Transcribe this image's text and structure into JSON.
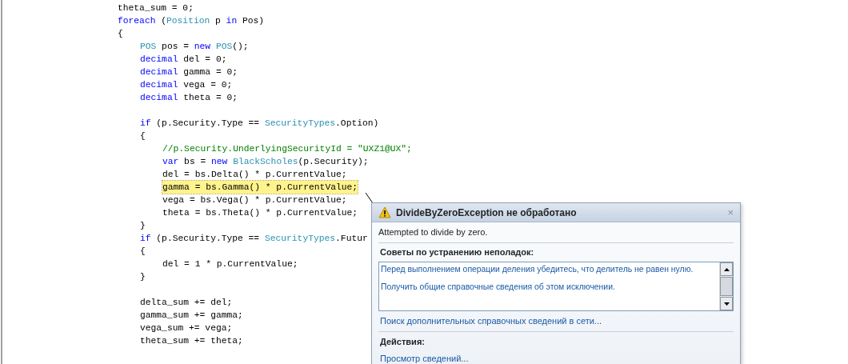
{
  "code_lines": [
    {
      "highlighted": false,
      "tokens": [
        {
          "kind": "plain",
          "text": "theta_sum = 0;"
        }
      ]
    },
    {
      "highlighted": false,
      "tokens": [
        {
          "kind": "keyword",
          "text": "foreach"
        },
        {
          "kind": "plain",
          "text": " ("
        },
        {
          "kind": "type",
          "text": "Position"
        },
        {
          "kind": "plain",
          "text": " p "
        },
        {
          "kind": "keyword",
          "text": "in"
        },
        {
          "kind": "plain",
          "text": " Pos)"
        }
      ]
    },
    {
      "highlighted": false,
      "tokens": [
        {
          "kind": "plain",
          "text": "{"
        }
      ],
      "children": [
        {
          "highlighted": false,
          "tokens": [
            {
              "kind": "type",
              "text": "POS"
            },
            {
              "kind": "plain",
              "text": " pos = "
            },
            {
              "kind": "keyword",
              "text": "new"
            },
            {
              "kind": "type",
              "text": " POS"
            },
            {
              "kind": "plain",
              "text": "();"
            }
          ]
        },
        {
          "highlighted": false,
          "tokens": [
            {
              "kind": "keyword",
              "text": "decimal"
            },
            {
              "kind": "plain",
              "text": " del = 0;"
            }
          ]
        },
        {
          "highlighted": false,
          "tokens": [
            {
              "kind": "keyword",
              "text": "decimal"
            },
            {
              "kind": "plain",
              "text": " gamma = 0;"
            }
          ]
        },
        {
          "highlighted": false,
          "tokens": [
            {
              "kind": "keyword",
              "text": "decimal"
            },
            {
              "kind": "plain",
              "text": " vega = 0;"
            }
          ]
        },
        {
          "highlighted": false,
          "tokens": [
            {
              "kind": "keyword",
              "text": "decimal"
            },
            {
              "kind": "plain",
              "text": " theta = 0;"
            }
          ]
        },
        {
          "highlighted": false,
          "space_before": true,
          "tokens": [
            {
              "kind": "keyword",
              "text": "if"
            },
            {
              "kind": "plain",
              "text": " (p.Security.Type == "
            },
            {
              "kind": "type",
              "text": "SecurityTypes"
            },
            {
              "kind": "plain",
              "text": ".Option)"
            }
          ]
        },
        {
          "highlighted": false,
          "tokens": [
            {
              "kind": "plain",
              "text": "{"
            }
          ],
          "children": [
            {
              "highlighted": false,
              "tokens": [
                {
                  "kind": "comment",
                  "text": "//p.Security.UnderlyingSecurityId = \"UXZ1@UX\";"
                }
              ]
            },
            {
              "highlighted": false,
              "tokens": [
                {
                  "kind": "keyword",
                  "text": "var"
                },
                {
                  "kind": "plain",
                  "text": " bs = "
                },
                {
                  "kind": "keyword",
                  "text": "new"
                },
                {
                  "kind": "type",
                  "text": " BlackScholes"
                },
                {
                  "kind": "plain",
                  "text": "(p.Security);"
                }
              ]
            },
            {
              "highlighted": false,
              "tokens": [
                {
                  "kind": "plain",
                  "text": "del = bs.Delta() * p.CurrentValue;"
                }
              ]
            },
            {
              "highlighted": true,
              "tokens": [
                {
                  "kind": "plain",
                  "text": "gamma = bs.Gamma() * p.CurrentValue;"
                }
              ]
            },
            {
              "highlighted": false,
              "tokens": [
                {
                  "kind": "plain",
                  "text": "vega = bs.Vega() * p.CurrentValue;"
                }
              ]
            },
            {
              "highlighted": false,
              "tokens": [
                {
                  "kind": "plain",
                  "text": "theta = bs.Theta() * p.CurrentValue;"
                }
              ]
            }
          ]
        },
        {
          "highlighted": false,
          "tokens": [
            {
              "kind": "plain",
              "text": "}"
            }
          ]
        },
        {
          "highlighted": false,
          "tokens": [
            {
              "kind": "keyword",
              "text": "if"
            },
            {
              "kind": "plain",
              "text": " (p.Security.Type == "
            },
            {
              "kind": "type",
              "text": "SecurityTypes"
            },
            {
              "kind": "plain",
              "text": ".Futur"
            }
          ]
        },
        {
          "highlighted": false,
          "tokens": [
            {
              "kind": "plain",
              "text": "{"
            }
          ],
          "children": [
            {
              "highlighted": false,
              "tokens": [
                {
                  "kind": "plain",
                  "text": "del = 1 * p.CurrentValue;"
                }
              ]
            }
          ]
        },
        {
          "highlighted": false,
          "tokens": [
            {
              "kind": "plain",
              "text": "}"
            }
          ]
        },
        {
          "highlighted": false,
          "space_before": true,
          "tokens": [
            {
              "kind": "plain",
              "text": "delta_sum += del;"
            }
          ]
        },
        {
          "highlighted": false,
          "tokens": [
            {
              "kind": "plain",
              "text": "gamma_sum += gamma;"
            }
          ]
        },
        {
          "highlighted": false,
          "tokens": [
            {
              "kind": "plain",
              "text": "vega_sum += vega;"
            }
          ]
        },
        {
          "highlighted": false,
          "tokens": [
            {
              "kind": "plain",
              "text": "theta_sum += theta;"
            }
          ]
        }
      ]
    }
  ],
  "exception_popup": {
    "title": "DivideByZeroException не обработано",
    "close_glyph": "×",
    "message": "Attempted to divide by zero.",
    "tips_heading": "Советы по устранению неполадок:",
    "tips": [
      "Перед выполнением операции деления убедитесь, что делитель не равен нулю.",
      "Получить общие справочные сведения об этом исключении."
    ],
    "online_help_link": "Поиск дополнительных справочных сведений в сети...",
    "actions_heading": "Действия:",
    "actions": [
      "Просмотр сведений..."
    ]
  }
}
